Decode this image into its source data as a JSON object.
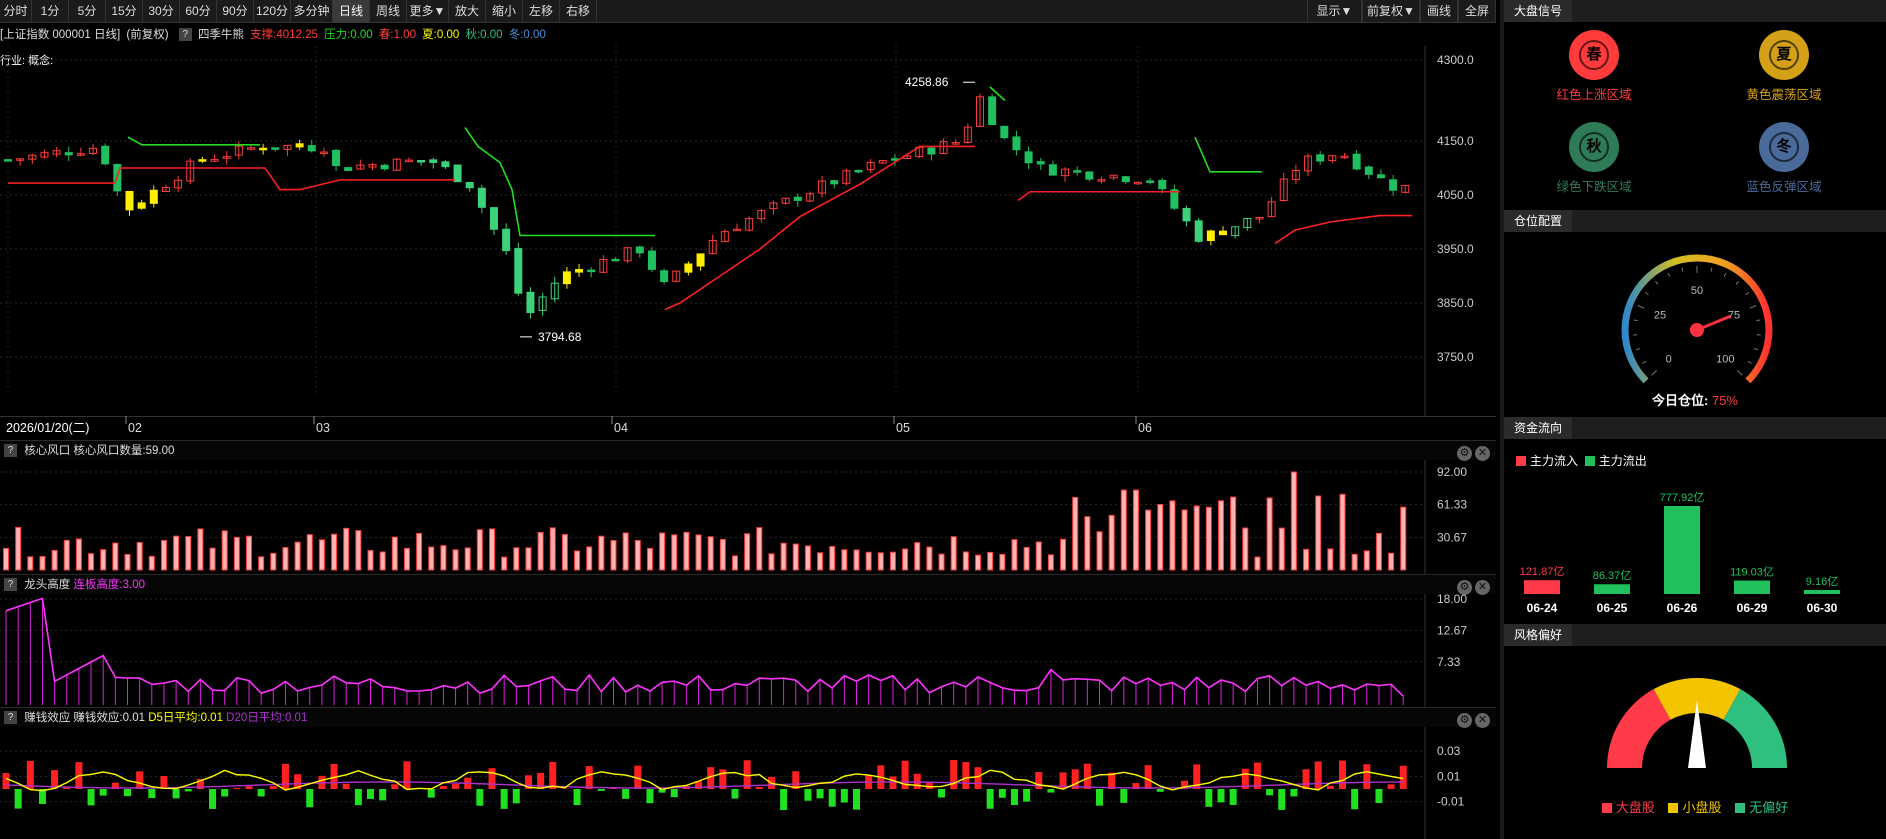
{
  "toolbar": {
    "left": [
      "分时",
      "1分",
      "5分",
      "15分",
      "30分",
      "60分",
      "90分",
      "120分",
      "多分钟",
      "日线",
      "周线",
      "更多▼",
      "放大",
      "缩小",
      "左移",
      "右移"
    ],
    "active": "日线",
    "right": [
      "显示▼",
      "前复权▼",
      "画线",
      "全屏"
    ]
  },
  "info": {
    "symbol": "[上证指数 000001 日线]",
    "adjust": "(前复权)",
    "help": "?",
    "indicator": "四季牛熊",
    "support": "支撑:4012.25",
    "pressure": "压力:0.00",
    "spring": "春:1.00",
    "summer": "夏:0.00",
    "autumn": "秋:0.00",
    "winter": "冬:0.00",
    "industry": "行业: 概念:"
  },
  "price_axis": [
    "4300.0",
    "4150.0",
    "4050.0",
    "3950.0",
    "3850.0",
    "3750.0"
  ],
  "price_labels": {
    "high": "4258.86",
    "low": "3794.68"
  },
  "date_bar": {
    "current": "2026/01/20(二)",
    "months": [
      "02",
      "03",
      "04",
      "05",
      "06"
    ]
  },
  "panel1": {
    "title": "核心风口",
    "value": "核心风口数量:59.00",
    "axis": [
      "92.00",
      "61.33",
      "30.67"
    ]
  },
  "panel2": {
    "title": "龙头高度",
    "value": "连板高度:3.00",
    "axis": [
      "18.00",
      "12.67",
      "7.33"
    ]
  },
  "panel3": {
    "title": "赚钱效应",
    "value": "赚钱效应:0.01",
    "d5": "D5日平均:0.01",
    "d20": "D20日平均:0.01",
    "axis": [
      "0.03",
      "0.01",
      "-0.01"
    ]
  },
  "right_panel": {
    "signal_title": "大盘信号",
    "seasons": [
      {
        "glyph": "春",
        "label": "红色上涨区域",
        "color": "#ff3b3b"
      },
      {
        "glyph": "夏",
        "label": "黄色震荡区域",
        "color": "#d4a017"
      },
      {
        "glyph": "秋",
        "label": "绿色下跌区域",
        "color": "#2f7a57"
      },
      {
        "glyph": "冬",
        "label": "蓝色反弹区域",
        "color": "#4a6a9a"
      }
    ],
    "position_title": "仓位配置",
    "gauge_ticks": [
      "0",
      "25",
      "50",
      "75",
      "100"
    ],
    "position_label": "今日仓位:",
    "position_value": "75%",
    "position_fraction": 0.75,
    "flow_title": "资金流向",
    "flow_legend": [
      "主力流入",
      "主力流出"
    ],
    "style_title": "风格偏好",
    "style_legend": [
      "大盘股",
      "小盘股",
      "无偏好"
    ]
  },
  "chart_data": [
    {
      "type": "bar",
      "title": "资金流向",
      "categories": [
        "06-24",
        "06-25",
        "06-26",
        "06-29",
        "06-30"
      ],
      "labels": [
        "121.87亿",
        "86.37亿",
        "777.92亿",
        "119.03亿",
        "9.16亿"
      ],
      "values": [
        121.87,
        86.37,
        777.92,
        119.03,
        9.16
      ],
      "colors": [
        "#ff3b4a",
        "#20c05c",
        "#20c05c",
        "#20c05c",
        "#20c05c"
      ]
    }
  ]
}
